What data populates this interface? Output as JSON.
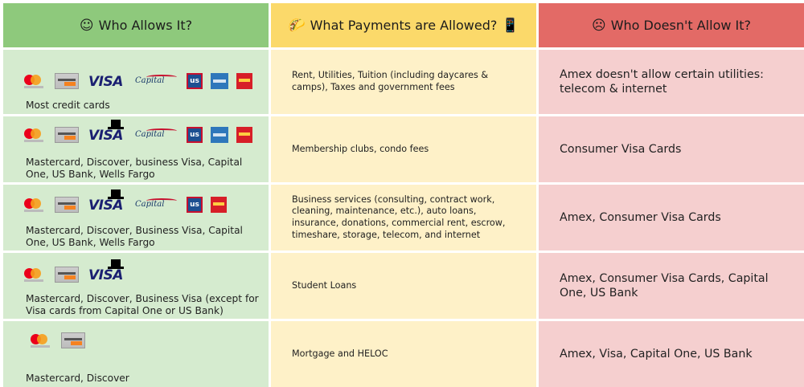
{
  "headers": {
    "who_allows": {
      "glyph": "☺",
      "label": "Who Allows It?"
    },
    "payments": {
      "glyph": "🌮",
      "label": "What Payments are Allowed?",
      "trail": "📱"
    },
    "who_not": {
      "glyph": "☹",
      "label": "Who Doesn't Allow It?"
    }
  },
  "rows": [
    {
      "who": "Most credit cards",
      "logos": [
        "mastercard-icon",
        "discover-icon",
        "visa-icon",
        "capital-one-icon",
        "us-bank-icon",
        "amex-icon",
        "wells-fargo-icon"
      ],
      "payments": "Rent, Utilities, Tuition (including daycares & camps), Taxes and government fees",
      "denied": "Amex doesn't allow certain utilities: telecom & internet"
    },
    {
      "who": "Mastercard, Discover, business Visa, Capital One, US Bank, Wells Fargo",
      "logos": [
        "mastercard-icon",
        "discover-icon",
        "business-visa-icon",
        "capital-one-icon",
        "us-bank-icon",
        "amex-icon",
        "wells-fargo-icon"
      ],
      "payments": "Membership clubs, condo fees",
      "denied": "Consumer Visa Cards"
    },
    {
      "who": "Mastercard, Discover, Business Visa, Capital One, US Bank, Wells Fargo",
      "logos": [
        "mastercard-icon",
        "discover-icon",
        "business-visa-icon",
        "capital-one-icon",
        "us-bank-icon",
        "wells-fargo-icon"
      ],
      "payments": "Business services (consulting, contract work, cleaning, maintenance, etc.), auto loans, insurance, donations, commercial rent, escrow, timeshare, storage, telecom, and internet",
      "denied": "Amex, Consumer Visa Cards"
    },
    {
      "who": "Mastercard, Discover, Business Visa (except for Visa cards from Capital One or US Bank)",
      "logos": [
        "mastercard-icon",
        "discover-icon",
        "business-visa-icon"
      ],
      "payments": "Student Loans",
      "denied": "Amex, Consumer Visa Cards, Capital One, US Bank"
    },
    {
      "who": "Mastercard, Discover",
      "logos": [
        "mastercard-icon",
        "discover-icon"
      ],
      "payments": "Mortgage and HELOC",
      "denied": "Amex, Visa, Capital One, US Bank"
    }
  ],
  "colors": {
    "green_header": "#8ec97c",
    "yellow_header": "#fbd96a",
    "red_header": "#e36a66"
  }
}
